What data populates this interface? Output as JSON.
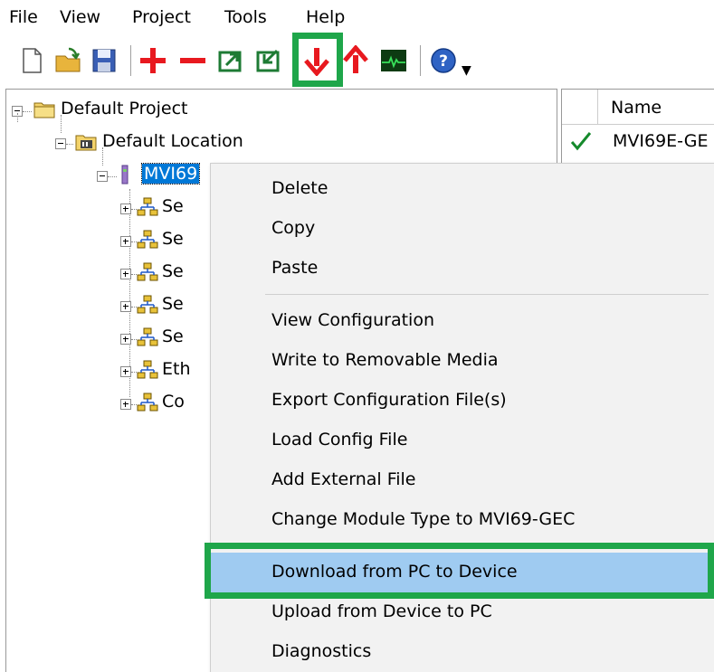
{
  "menubar": {
    "items": [
      "File",
      "View",
      "Project",
      "Tools",
      "Help"
    ]
  },
  "toolbar": {
    "buttons": [
      "new-file-icon",
      "open-folder-icon",
      "save-icon",
      "add-icon",
      "remove-icon",
      "export-icon",
      "import-icon",
      "download-icon",
      "upload-icon",
      "diagnostics-icon",
      "help-icon"
    ],
    "highlighted": "download-icon",
    "highlight_color": "#1fa64a"
  },
  "tree": {
    "project": "Default Project",
    "location": "Default Location",
    "module": "MVI69",
    "children": [
      "Se",
      "Se",
      "Se",
      "Se",
      "Se",
      "Eth",
      "Co"
    ]
  },
  "list": {
    "header": "Name",
    "rows": [
      {
        "status": "check-icon",
        "name": "MVI69E-GE"
      }
    ]
  },
  "context_menu": {
    "groups": [
      [
        "Delete",
        "Copy",
        "Paste"
      ],
      [
        "View Configuration",
        "Write to Removable Media",
        "Export Configuration File(s)",
        "Load Config File",
        "Add External File",
        "Change Module Type to MVI69-GEC"
      ],
      [
        "Download from PC to Device",
        "Upload from Device to PC",
        "Diagnostics"
      ]
    ],
    "active_item": "Download from PC to Device",
    "active_color": "#9fcbf1",
    "highlight_color": "#1fa64a"
  }
}
